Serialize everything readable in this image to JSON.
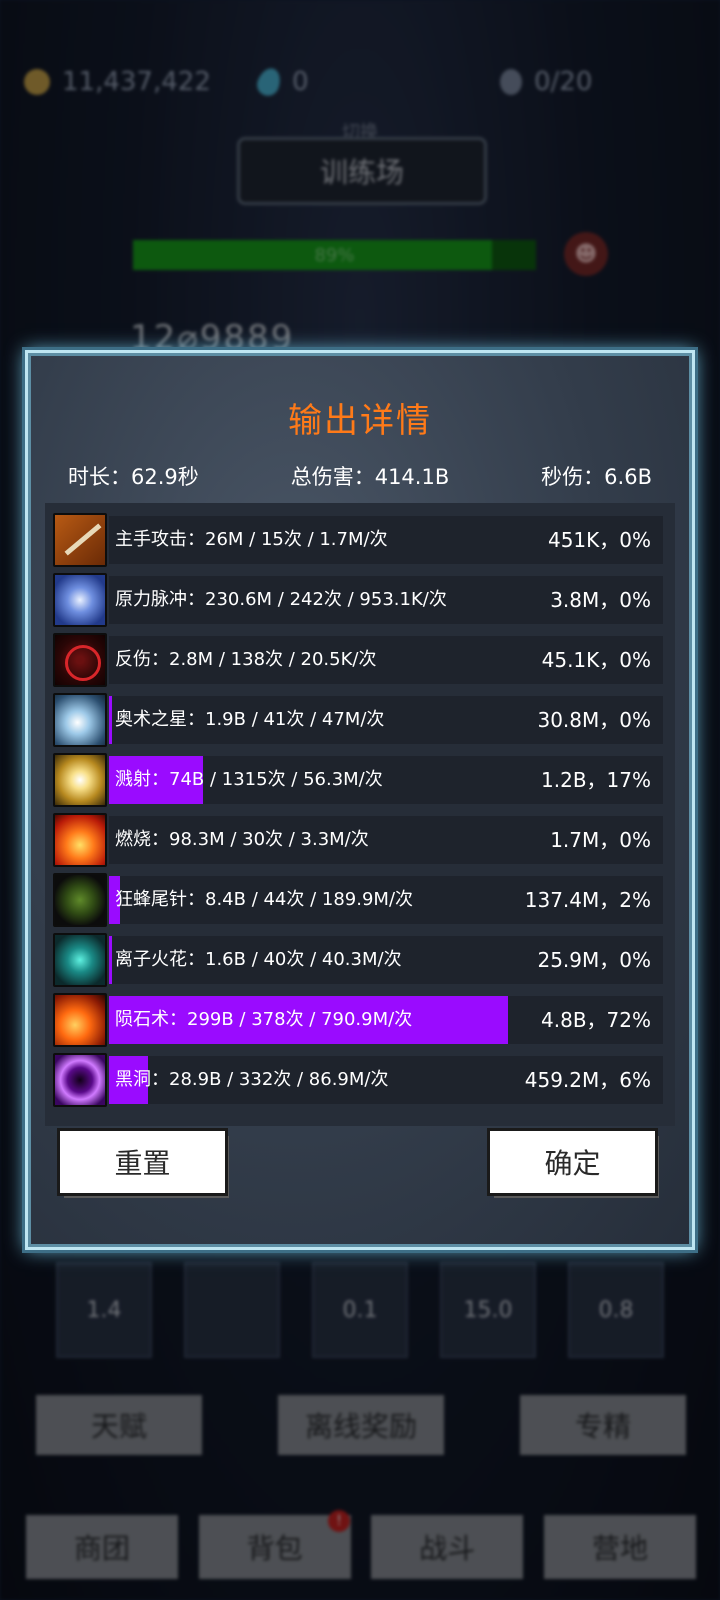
{
  "background": {
    "gold": "11,437,422",
    "gems": "0",
    "capacity": "0/20",
    "switch_label": "切换",
    "stage_name": "训练场",
    "boss_hp_text": "89%",
    "boss_hp_fraction": 0.89,
    "damage_popup": "12⌀9889",
    "skill_slots": [
      "1.4",
      "",
      "0.1",
      "15.0",
      "0.8"
    ],
    "buttons": [
      "天赋",
      "离线奖励",
      "专精"
    ],
    "nav": [
      "商团",
      "背包",
      "战斗",
      "营地"
    ],
    "nav_badge": "!"
  },
  "dialog": {
    "title": "输出详情",
    "duration": "时长：62.9秒",
    "total_damage": "总伤害：414.1B",
    "dps": "秒伤：6.6B",
    "rows": [
      {
        "icon": "sword-icon",
        "label": "主手攻击：26M  /  15次  /  1.7M/次",
        "right": "451K，0%",
        "fraction": 0.0
      },
      {
        "icon": "force-pulse-icon",
        "label": "原力脉冲：230.6M  /  242次  /  953.1K/次",
        "right": "3.8M，0%",
        "fraction": 0.0
      },
      {
        "icon": "thorns-icon",
        "label": "反伤：2.8M  /  138次  /  20.5K/次",
        "right": "45.1K，0%",
        "fraction": 0.0
      },
      {
        "icon": "arcane-star-icon",
        "label": "奥术之星：1.9B  /  41次  /  47M/次",
        "right": "30.8M，0%",
        "fraction": 0.005
      },
      {
        "icon": "splash-icon",
        "label": "溅射：74B  /  1315次  /  56.3M/次",
        "right": "1.2B，17%",
        "fraction": 0.17
      },
      {
        "icon": "burn-icon",
        "label": "燃烧：98.3M  /  30次  /  3.3M/次",
        "right": "1.7M，0%",
        "fraction": 0.0
      },
      {
        "icon": "wasp-stinger-icon",
        "label": "狂蜂尾针：8.4B  /  44次  /  189.9M/次",
        "right": "137.4M，2%",
        "fraction": 0.02
      },
      {
        "icon": "ion-spark-icon",
        "label": "离子火花：1.6B  /  40次  /  40.3M/次",
        "right": "25.9M，0%",
        "fraction": 0.004
      },
      {
        "icon": "meteor-icon",
        "label": "陨石术：299B  /  378次  /  790.9M/次",
        "right": "4.8B，72%",
        "fraction": 0.72
      },
      {
        "icon": "black-hole-icon",
        "label": "黑洞：28.9B  /  332次  /  86.9M/次",
        "right": "459.2M，6%",
        "fraction": 0.07
      }
    ],
    "reset_label": "重置",
    "confirm_label": "确定"
  },
  "colors": {
    "title": "#ff7a18",
    "bar_fill": "#9a0bff"
  }
}
